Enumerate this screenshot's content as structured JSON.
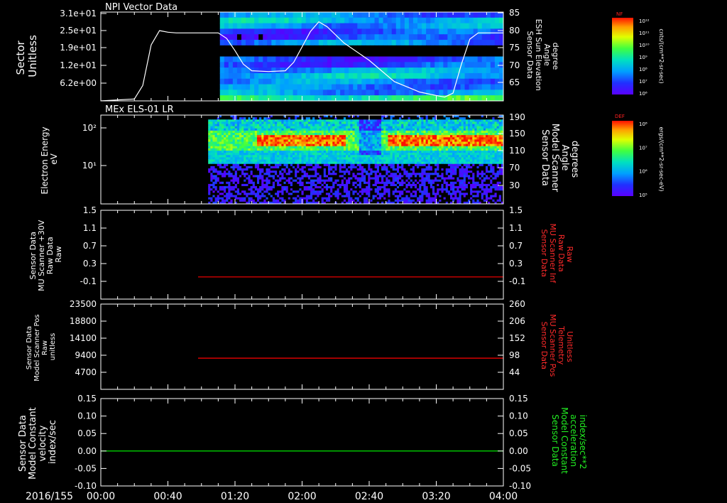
{
  "chart_data": [
    {
      "type": "heatmap",
      "title": "NPI Vector Data",
      "ylabel_lines": [
        "Sector",
        "Unitless"
      ],
      "yticks_left": [
        "3.1e+01",
        "2.5e+01",
        "1.9e+01",
        "1.2e+01",
        "6.2e+00"
      ],
      "y2label_lines": [
        "Sensor Data",
        "ESH Sun Elevation",
        "Angle",
        "degree"
      ],
      "y2ticks": [
        "85",
        "80",
        "75",
        "70",
        "65"
      ],
      "y2lim": [
        62,
        85
      ],
      "data_start": "01:11",
      "overlay_line": {
        "name": "ESH Sun Elevation Angle",
        "color": "#ffffff",
        "points": [
          [
            "00:00",
            62.0
          ],
          [
            "00:20",
            62.5
          ],
          [
            "00:25",
            66.0
          ],
          [
            "00:30",
            76.5
          ],
          [
            "00:35",
            80.2
          ],
          [
            "00:40",
            79.8
          ],
          [
            "00:45",
            79.6
          ],
          [
            "01:00",
            79.6
          ],
          [
            "01:10",
            79.6
          ],
          [
            "01:15",
            78.2
          ],
          [
            "01:20",
            75.0
          ],
          [
            "01:25",
            71.5
          ],
          [
            "01:30",
            69.8
          ],
          [
            "01:40",
            69.6
          ],
          [
            "01:50",
            69.8
          ],
          [
            "01:55",
            72.0
          ],
          [
            "02:05",
            80.0
          ],
          [
            "02:10",
            82.5
          ],
          [
            "02:15",
            81.2
          ],
          [
            "02:25",
            77.0
          ],
          [
            "02:40",
            72.5
          ],
          [
            "02:55",
            67.0
          ],
          [
            "03:10",
            64.3
          ],
          [
            "03:20",
            63.4
          ],
          [
            "03:25",
            63.0
          ],
          [
            "03:30",
            64.0
          ],
          [
            "03:35",
            71.5
          ],
          [
            "03:40",
            78.0
          ],
          [
            "03:45",
            79.6
          ],
          [
            "04:00",
            79.6
          ]
        ]
      },
      "colorbar": {
        "label": "NF",
        "ticks": [
          "10¹²",
          "10¹¹",
          "10¹⁰",
          "10⁹",
          "10⁸",
          "10⁷",
          "10⁶"
        ],
        "units": "cnts/(cm**2-sr-sec)"
      }
    },
    {
      "type": "heatmap",
      "title": "MEx ELS-01 LR",
      "ylabel_lines": [
        "Electron Energy",
        "eV"
      ],
      "yticks_left": [
        "10²",
        "10¹"
      ],
      "y2label_lines": [
        "Sensor Data",
        "Model Scanner",
        "Angle",
        "degrees"
      ],
      "y2ticks": [
        "190",
        "150",
        "110",
        "70",
        "30"
      ],
      "y2lim": [
        5,
        190
      ],
      "data_start": "01:04",
      "overlay_line": {
        "name": "Model Scanner Angle",
        "color": "#ffffff",
        "value": 5
      },
      "colorbar": {
        "label": "DEF",
        "ticks": [
          "10⁸",
          "10⁷",
          "10⁶",
          "10⁵"
        ],
        "units": "ergs/(cm**2-sr-sec-eV)"
      }
    },
    {
      "type": "line",
      "ylabel_lines": [
        "Sensor Data",
        "MU Scanner +30V",
        "Raw Data",
        "Raw"
      ],
      "yticks": [
        "1.5",
        "1.1",
        "0.7",
        "0.3",
        "-0.1"
      ],
      "ylim": [
        -0.5,
        1.5
      ],
      "y2label_lines": [
        "Sensor Data",
        "MU Scanner Inf",
        "Raw Data",
        "Raw"
      ],
      "y2ticks": [
        "1.5",
        "1.1",
        "0.7",
        "0.3",
        "-0.1"
      ],
      "series": [
        {
          "name": "MU Scanner Inf",
          "color": "#ff0000",
          "x": [
            "00:58",
            "04:00"
          ],
          "y": [
            0.0,
            0.0
          ]
        }
      ]
    },
    {
      "type": "line",
      "ylabel_lines": [
        "Sensor Data",
        "Model Scanner Pos",
        "Raw",
        "unitless"
      ],
      "yticks": [
        "23500",
        "18800",
        "14100",
        "9400",
        "4700"
      ],
      "ylim": [
        0,
        23500
      ],
      "y2label_lines": [
        "Sensor Data",
        "MU Scanner Pos",
        "Telemetry",
        "Unitless"
      ],
      "y2ticks": [
        "260",
        "206",
        "152",
        "98",
        "44"
      ],
      "series": [
        {
          "name": "MU Scanner Pos",
          "color": "#ff0000",
          "x": [
            "00:58",
            "04:00"
          ],
          "y": [
            8600,
            8600
          ]
        }
      ]
    },
    {
      "type": "line",
      "ylabel_lines": [
        "Sensor Data",
        "Model Constant",
        "velocity",
        "index/sec"
      ],
      "yticks": [
        "0.15",
        "0.10",
        "0.05",
        "0.00",
        "-0.05",
        "-0.10"
      ],
      "ylim": [
        -0.1,
        0.15
      ],
      "y2label_lines": [
        "Sensor Data",
        "Model Constant",
        "acceleration",
        "index/sec**2"
      ],
      "y2ticks": [
        "0.15",
        "0.10",
        "0.05",
        "0.00",
        "-0.05",
        "-0.10"
      ],
      "series": [
        {
          "name": "Model Constant acceleration",
          "color": "#00ff00",
          "x": [
            "00:00",
            "04:00"
          ],
          "y": [
            0.0,
            0.0
          ]
        }
      ]
    }
  ],
  "x_axis": {
    "date": "2016/155",
    "ticks": [
      "00:00",
      "00:40",
      "01:20",
      "02:00",
      "02:40",
      "03:20",
      "04:00"
    ],
    "range": [
      "00:00",
      "04:00"
    ]
  },
  "colors": {
    "background": "#000000",
    "axes": "#ffffff"
  }
}
